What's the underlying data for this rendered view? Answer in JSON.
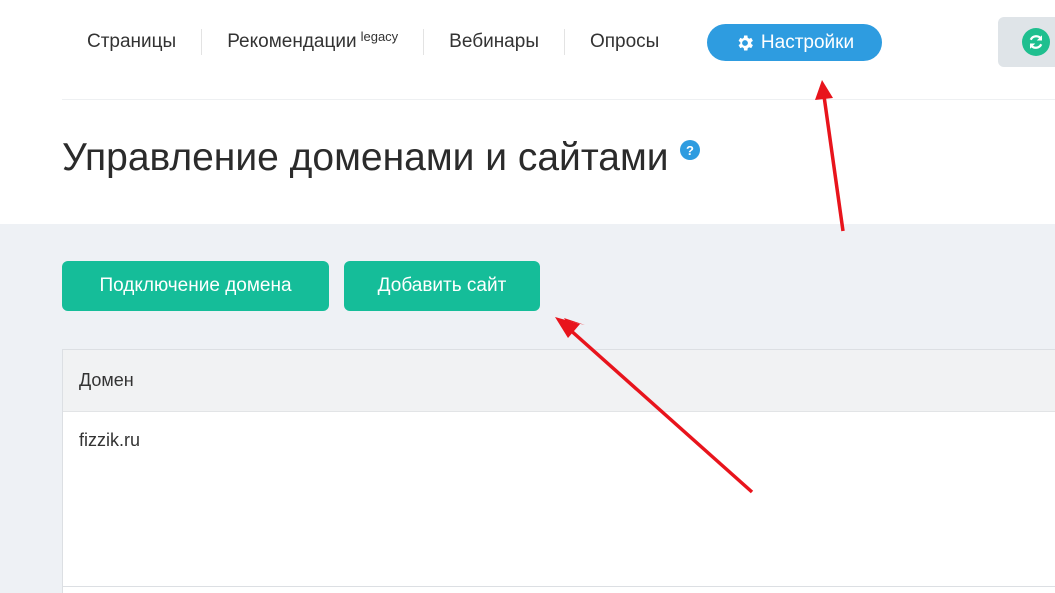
{
  "nav": {
    "items": [
      {
        "label": "Страницы"
      },
      {
        "label": "Рекомендации",
        "sup": "legacy"
      },
      {
        "label": "Вебинары"
      },
      {
        "label": "Опросы"
      }
    ],
    "active_label": "Настройки"
  },
  "page": {
    "title": "Управление доменами и сайтами",
    "help": "?"
  },
  "actions": {
    "connect_domain": "Подключение домена",
    "add_site": "Добавить сайт"
  },
  "table": {
    "header": "Домен",
    "rows": [
      {
        "domain": "fizzik.ru"
      }
    ]
  },
  "colors": {
    "accent_blue": "#2e9ce0",
    "accent_green": "#15bd99",
    "annotation_red": "#e8141c"
  },
  "icons": [
    "gear-icon",
    "refresh-icon",
    "help-icon"
  ]
}
